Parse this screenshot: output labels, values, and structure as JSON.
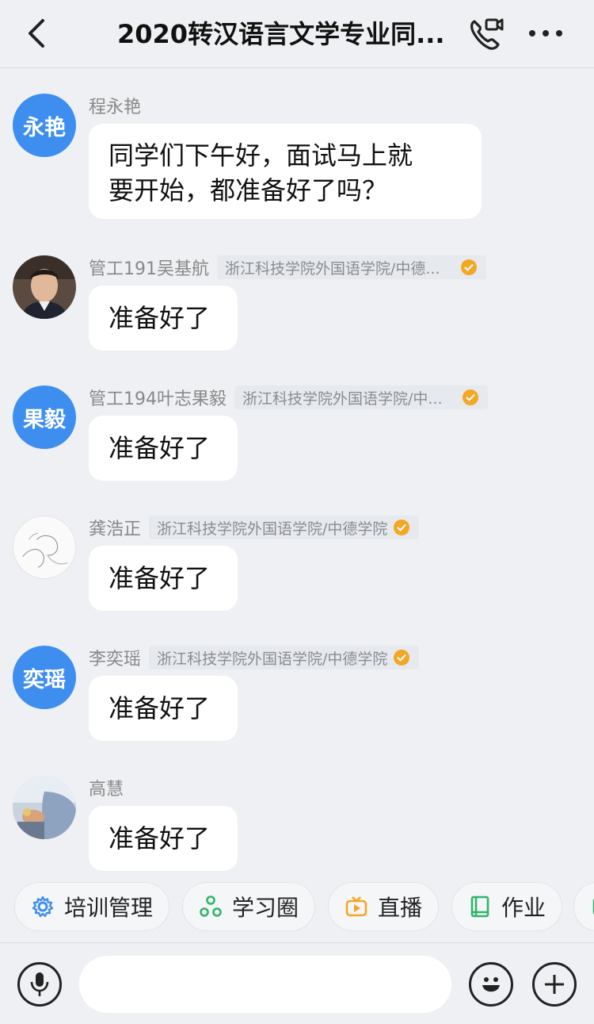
{
  "header": {
    "title": "2020转汉语言文学专业同...",
    "back_icon": "chevron-left-icon",
    "call_icon": "phone-video-icon",
    "more_icon": "more-horizontal-icon"
  },
  "messages": [
    {
      "avatar_text": "永艳",
      "name": "程永艳",
      "org": "",
      "text": "同学们下午好，面试马上就\n要开始，都准备好了吗？"
    },
    {
      "avatar_text": "",
      "name": "管工191吴基航",
      "org": "浙江科技学院外国语学院/中德...",
      "text": "准备好了"
    },
    {
      "avatar_text": "果毅",
      "name": "管工194叶志果毅",
      "org": "浙江科技学院外国语学院/中...",
      "text": "准备好了"
    },
    {
      "avatar_text": "",
      "name": "龚浩正",
      "org": "浙江科技学院外国语学院/中德学院",
      "text": "准备好了"
    },
    {
      "avatar_text": "奕瑶",
      "name": "李奕瑶",
      "org": "浙江科技学院外国语学院/中德学院",
      "text": "准备好了"
    },
    {
      "avatar_text": "",
      "name": "高慧",
      "org": "",
      "text": "准备好了"
    }
  ],
  "quickbar": [
    {
      "label": "培训管理",
      "icon": "gear-icon",
      "color": "#3e8ef0"
    },
    {
      "label": "学习圈",
      "icon": "circle-nodes-icon",
      "color": "#2fb56a"
    },
    {
      "label": "直播",
      "icon": "live-tv-icon",
      "color": "#f5a623"
    },
    {
      "label": "作业",
      "icon": "book-icon",
      "color": "#2fb56a"
    }
  ],
  "inputbar": {
    "mic_icon": "microphone-icon",
    "input_value": "",
    "thumb_icon": "thumbs-up-icon",
    "emoji_icon": "emoji-icon",
    "plus_icon": "plus-icon"
  },
  "colors": {
    "accent": "#3e8ef0",
    "verified": "#f5a623",
    "background": "#eef0f3"
  }
}
